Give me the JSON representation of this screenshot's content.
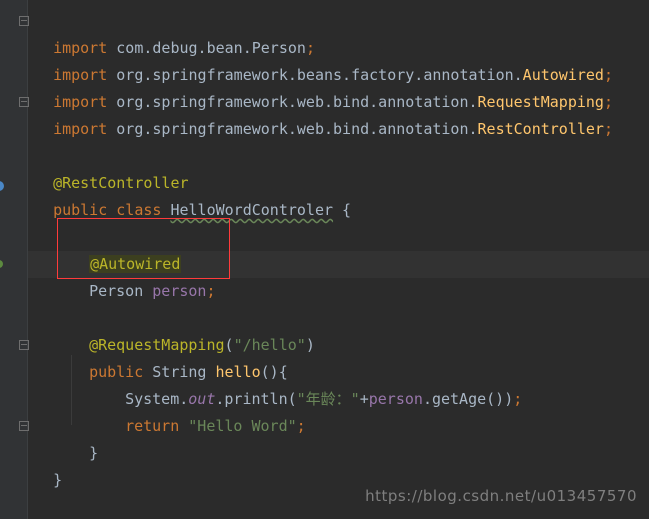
{
  "editor": {
    "lines": {
      "l1": {
        "kw": "import",
        "rest": " com.debug.bean.Person",
        "semi": ";"
      },
      "l2": {
        "kw": "import",
        "pkg": " org.springframework.beans.factory.annotation.",
        "cls": "Autowired",
        "semi": ";"
      },
      "l3": {
        "kw": "import",
        "pkg": " org.springframework.web.bind.annotation.",
        "cls": "RequestMapping",
        "semi": ";"
      },
      "l4": {
        "kw": "import",
        "pkg": " org.springframework.web.bind.annotation.",
        "cls": "RestController",
        "semi": ";"
      },
      "l6": {
        "ann": "@RestController"
      },
      "l7": {
        "kw": "public class",
        "name": "HelloWordControler",
        "brace": " {"
      },
      "l9": {
        "ann": "@Autowired"
      },
      "l10": {
        "type": "Person ",
        "field": "person",
        "semi": ";"
      },
      "l12": {
        "ann": "@RequestMapping",
        "open": "(",
        "str": "\"/hello\"",
        "close": ")"
      },
      "l13": {
        "kw": "public ",
        "type": "String ",
        "fn": "hello",
        "rest": "(){"
      },
      "l14": {
        "obj": "System.",
        "out": "out",
        "call": ".println(",
        "str": "\"年龄：\"",
        "plus": "+",
        "field": "person",
        "rest": ".getAge())",
        "semi": ";"
      },
      "l15": {
        "kw": "return ",
        "str": "\"Hello Word\"",
        "semi": ";"
      },
      "l16": {
        "brace": "}"
      },
      "l17": {
        "brace": "}"
      }
    }
  },
  "watermark": "https://blog.csdn.net/u013457570",
  "colors": {
    "background": "#2b2b2b",
    "keyword": "#cc7832",
    "annotation": "#bbb529",
    "class": "#ffc66d",
    "field": "#9876aa",
    "string": "#6a8759",
    "highlight_box": "#ff3b3b"
  }
}
